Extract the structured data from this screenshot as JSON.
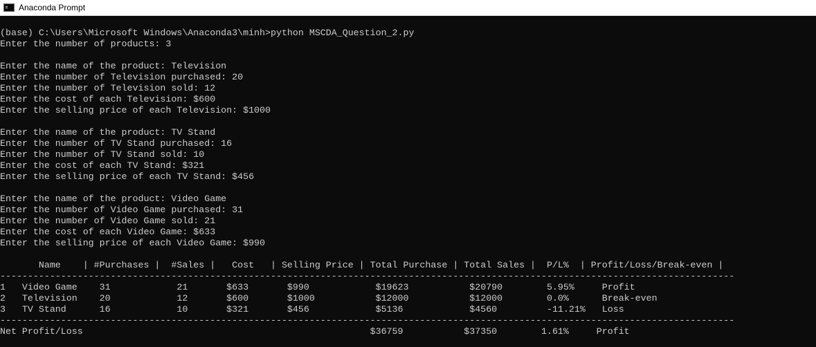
{
  "window": {
    "title": "Anaconda Prompt",
    "icon": "console-icon"
  },
  "console": {
    "text_color": "#cccccc",
    "background": "#0c0c0c",
    "lines": [
      "(base) C:\\Users\\Microsoft Windows\\Anaconda3\\minh>python MSCDA_Question_2.py",
      "Enter the number of products: 3",
      "",
      "Enter the name of the product: Television",
      "Enter the number of Television purchased: 20",
      "Enter the number of Television sold: 12",
      "Enter the cost of each Television: $600",
      "Enter the selling price of each Television: $1000",
      "",
      "Enter the name of the product: TV Stand",
      "Enter the number of TV Stand purchased: 16",
      "Enter the number of TV Stand sold: 10",
      "Enter the cost of each TV Stand: $321",
      "Enter the selling price of each TV Stand: $456",
      "",
      "Enter the name of the product: Video Game",
      "Enter the number of Video Game purchased: 31",
      "Enter the number of Video Game sold: 21",
      "Enter the cost of each Video Game: $633",
      "Enter the selling price of each Video Game: $990",
      "",
      "       Name    | #Purchases |  #Sales |   Cost   | Selling Price | Total Purchase | Total Sales |  P/L%  | Profit/Loss/Break-even |",
      "-------------------------------------------------------------------------------------------------------------------------------------",
      "1   Video Game    31            21       $633       $990            $19623           $20790        5.95%     Profit",
      "2   Television    20            12       $600       $1000           $12000           $12000        0.0%      Break-even",
      "3   TV Stand      16            10       $321       $456            $5136            $4560         -11.21%   Loss",
      "-------------------------------------------------------------------------------------------------------------------------------------",
      "Net Profit/Loss                                                    $36759           $37350        1.61%     Profit"
    ]
  }
}
